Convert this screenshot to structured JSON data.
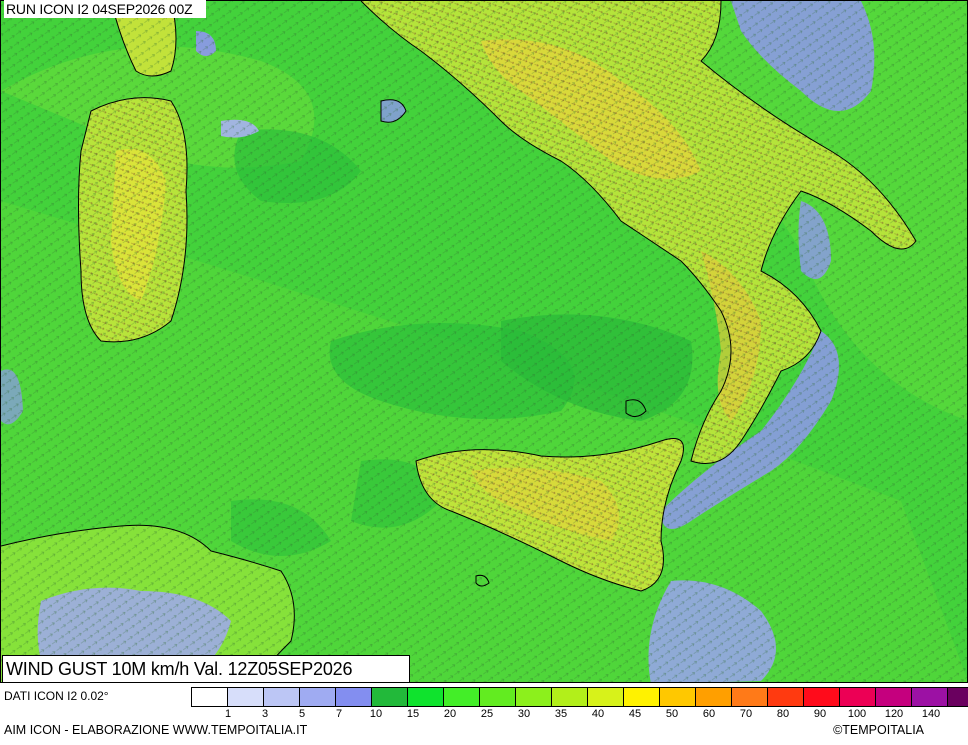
{
  "run_label": "RUN ICON I2 04SEP2026 00Z",
  "title": "WIND GUST 10M km/h Val. 12Z05SEP2026",
  "data_source": "DATI ICON I2 0.02°",
  "credit": "AIM ICON - ELABORAZIONE WWW.TEMPOITALIA.IT",
  "brand": "©TEMPOITALIA",
  "scale": {
    "colors": [
      "#ffffff",
      "#d7defa",
      "#bcc6f5",
      "#9fabf2",
      "#838ef0",
      "#22b93a",
      "#0fe32d",
      "#43ee28",
      "#62ec20",
      "#8cf01c",
      "#b2ef1a",
      "#d7f21a",
      "#fff200",
      "#ffc800",
      "#ff9f00",
      "#ff7a18",
      "#ff3a10",
      "#ff0b1b",
      "#ec0055",
      "#c5007e",
      "#9c11a4",
      "#6a005f"
    ],
    "labels": [
      "1",
      "3",
      "5",
      "7",
      "10",
      "15",
      "20",
      "25",
      "30",
      "35",
      "40",
      "45",
      "50",
      "60",
      "70",
      "80",
      "90",
      "100",
      "120",
      "140"
    ]
  },
  "icons": {
    "arrow": "wind-arrow-icon"
  }
}
